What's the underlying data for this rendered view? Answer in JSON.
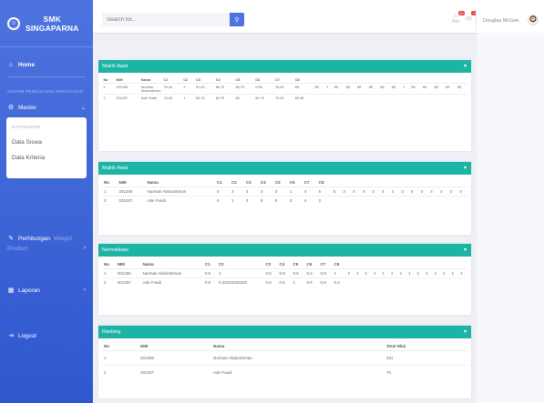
{
  "brand": {
    "line1": "SMK",
    "line2": "SINGAPARNA"
  },
  "sidebar": {
    "home": "Home",
    "section_heading": "SISTEM PENDUKUNG KEPUTUSAN",
    "master": "Master",
    "submenu_heading": "DATA MASTER",
    "submenu_items": [
      "Data Siswa",
      "Data Kriteria"
    ],
    "perhitungan": "Perhitungan",
    "perhitungan_extra1": "Weight",
    "perhitungan_extra2": "Product",
    "laporan": "Laporan",
    "logout": "Logout"
  },
  "topbar": {
    "search_placeholder": "Search for...",
    "alerts_badge": "3+",
    "messages_badge": "7",
    "username": "Douglas McGee"
  },
  "cards": [
    {
      "title": "Matrik Awal",
      "headers": [
        "No",
        "NIM",
        "Nama",
        "C1",
        "C2",
        "C3",
        "C4",
        "C5",
        "C6",
        "C7",
        "C8"
      ],
      "rows": [
        [
          "1",
          "201256",
          "Nurman Abdurahman",
          "76.49",
          "1",
          "91.49",
          "86.79",
          "86.75",
          "0.85",
          "78.49",
          "85"
        ],
        [
          "2",
          "201257",
          "Ade Fuadi",
          "76.49",
          "1",
          "84.75",
          "84.79",
          "86",
          "84.75",
          "76.49",
          "80.46"
        ]
      ],
      "extra": [
        "85",
        "1",
        "85",
        "85",
        "85",
        "85",
        "85",
        "85",
        "1",
        "85",
        "85",
        "85",
        "85",
        "85"
      ]
    },
    {
      "title": "Matrik Awal",
      "headers": [
        "No",
        "NIM",
        "Nama",
        "C1",
        "C2",
        "C3",
        "C4",
        "C5",
        "C6",
        "C7",
        "C8"
      ],
      "rows": [
        [
          "1",
          "201256",
          "Nurman Abdurahman",
          "4",
          "3",
          "3",
          "3",
          "3",
          "1",
          "4",
          "5"
        ],
        [
          "2",
          "201257",
          "Ade Fuadi",
          "4",
          "1",
          "3",
          "5",
          "5",
          "3",
          "4",
          "2"
        ]
      ],
      "extra": [
        "5",
        "3",
        "4",
        "4",
        "4",
        "4",
        "4",
        "3",
        "4",
        "4",
        "4",
        "4",
        "4",
        "4"
      ]
    },
    {
      "title": "Normalisasi",
      "headers": [
        "No",
        "NIM",
        "Nama",
        "C1",
        "C2",
        "C3",
        "C4",
        "C5",
        "C6",
        "C7",
        "C8"
      ],
      "rows": [
        [
          "1",
          "201256",
          "Nurman Abdurahman",
          "0.6",
          "1",
          "0.6",
          "0.8",
          "0.6",
          "0.2",
          "0.8",
          "1"
        ],
        [
          "2",
          "201257",
          "Ade Fuadi",
          "0.6",
          "0.33333333333",
          "0.6",
          "0.6",
          "1",
          "0.6",
          "0.8",
          "0.4"
        ]
      ],
      "extra": [
        "2",
        "1",
        "1",
        "1",
        "1",
        "1",
        "1",
        "1",
        "1",
        "1",
        "1",
        "1",
        "1",
        "1"
      ]
    },
    {
      "title": "Ranking",
      "headers": [
        "No",
        "NIM",
        "Nama",
        "Total Nilai"
      ],
      "rows": [
        [
          "1",
          "201256",
          "Nurman Abdurahman",
          "101"
        ],
        [
          "2",
          "201257",
          "Ade Fuadi",
          "76"
        ]
      ]
    }
  ],
  "colors": {
    "sidebar": "#4e73df",
    "card_header": "#1cb5a5",
    "accent": "#4e73df"
  }
}
